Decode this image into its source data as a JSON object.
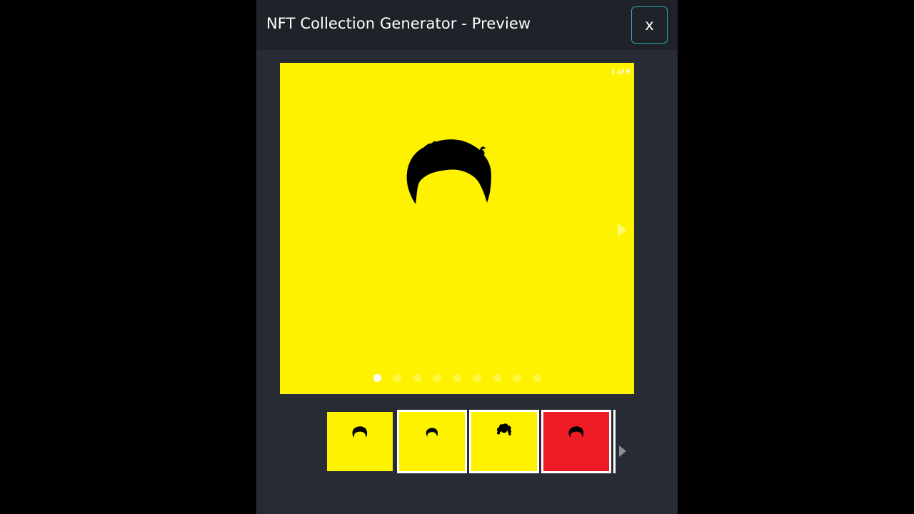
{
  "modal": {
    "title": "NFT Collection Generator - Preview",
    "close_label": "x"
  },
  "slider": {
    "counter": "1 of 9",
    "current": 1,
    "total": 9,
    "background": "#fff200",
    "hair_icon": "hair-silhouette-icon",
    "next_icon": "chevron-right-icon"
  },
  "thumbnails": [
    {
      "background": "#fff200",
      "hair_style": "short",
      "active": true
    },
    {
      "background": "#fff200",
      "hair_style": "small",
      "active": false
    },
    {
      "background": "#fff200",
      "hair_style": "curly",
      "active": false
    },
    {
      "background": "#ed1c24",
      "hair_style": "short",
      "active": false
    }
  ],
  "colors": {
    "accent": "#2aa7b5",
    "modal_bg": "#272b33",
    "header_bg": "#1f2329"
  }
}
